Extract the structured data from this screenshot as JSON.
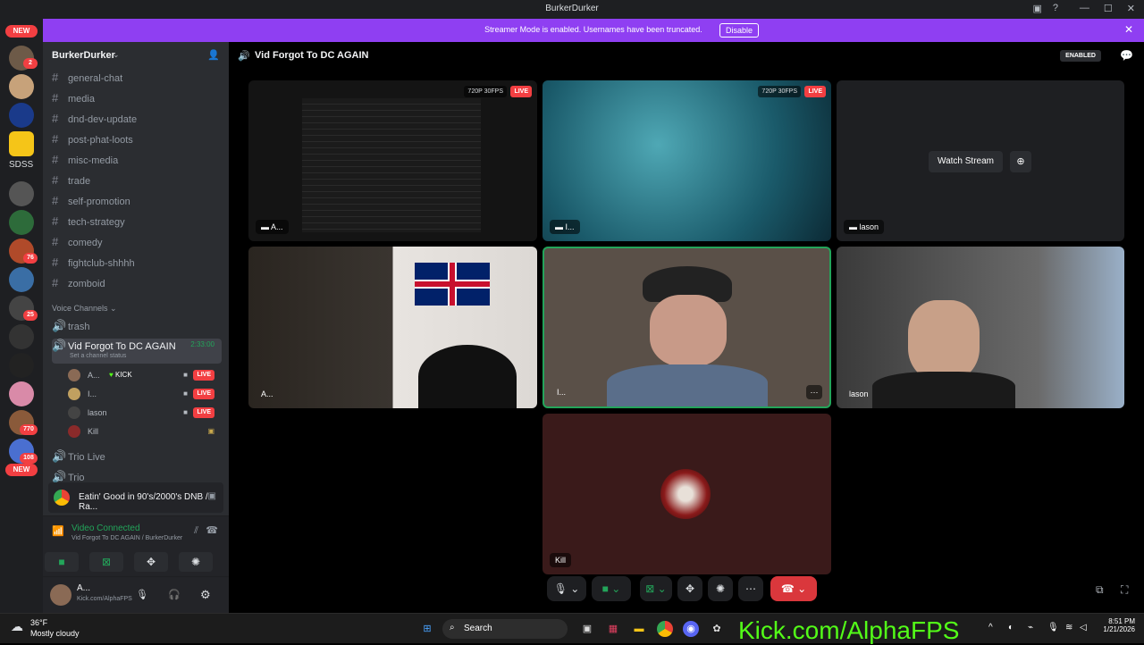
{
  "window": {
    "title": "BurkerDurker"
  },
  "banner": {
    "text": "Streamer Mode is enabled. Usernames have been truncated.",
    "disable_label": "Disable"
  },
  "servers": {
    "new_top": "NEW",
    "sdss": "SDSS",
    "badges": [
      "2",
      "76",
      "25",
      "770",
      "108"
    ],
    "new_bottom": "NEW"
  },
  "guild": {
    "name": "BurkerDurker"
  },
  "channels": [
    "general-chat",
    "media",
    "dnd-dev-update",
    "post-phat-loots",
    "misc-media",
    "trade",
    "self-promotion",
    "tech-strategy",
    "comedy",
    "fightclub-shhhh",
    "zomboid"
  ],
  "voice": {
    "category": "Voice Channels",
    "channels": [
      {
        "name": "trash"
      },
      {
        "name": "Vid Forgot To DC AGAIN",
        "timer": "2:33:00",
        "status": "Set a channel status"
      },
      {
        "name": "Trio Live"
      },
      {
        "name": "Trio"
      }
    ],
    "users": [
      {
        "name": "A...",
        "tag": "KICK",
        "live": "LIVE"
      },
      {
        "name": "I...",
        "live": "LIVE"
      },
      {
        "name": "lason",
        "live": "LIVE"
      },
      {
        "name": "Kill"
      }
    ]
  },
  "activity": {
    "text": "Eatin' Good in 90's/2000's DNB / Ra..."
  },
  "voice_panel": {
    "status": "Video Connected",
    "location": "Vid Forgot To DC AGAIN / BurkerDurker"
  },
  "user_panel": {
    "name": "A...",
    "status": "Kick.com/AlphaFPS"
  },
  "call": {
    "title": "Vid Forgot To DC AGAIN",
    "enabled_label": "ENABLED",
    "tiles": [
      {
        "name": "A...",
        "quality": "720P 30FPS",
        "live": "LIVE"
      },
      {
        "name": "I...",
        "quality": "720P 30FPS",
        "live": "LIVE"
      },
      {
        "name": "lason",
        "watch": "Watch Stream"
      },
      {
        "name": "A..."
      },
      {
        "name": "I..."
      },
      {
        "name": "lason"
      },
      {
        "name": "Kill"
      }
    ]
  },
  "taskbar": {
    "weather_temp": "36°F",
    "weather_desc": "Mostly cloudy",
    "search": "Search",
    "time": "8:51 PM",
    "date": "1/21/2026",
    "overlay": "Kick.com/AlphaFPS"
  },
  "colors": {
    "blurple": "#8f3ff2",
    "live_red": "#f23f42",
    "green": "#23a55a",
    "kick_green": "#53fc18"
  }
}
